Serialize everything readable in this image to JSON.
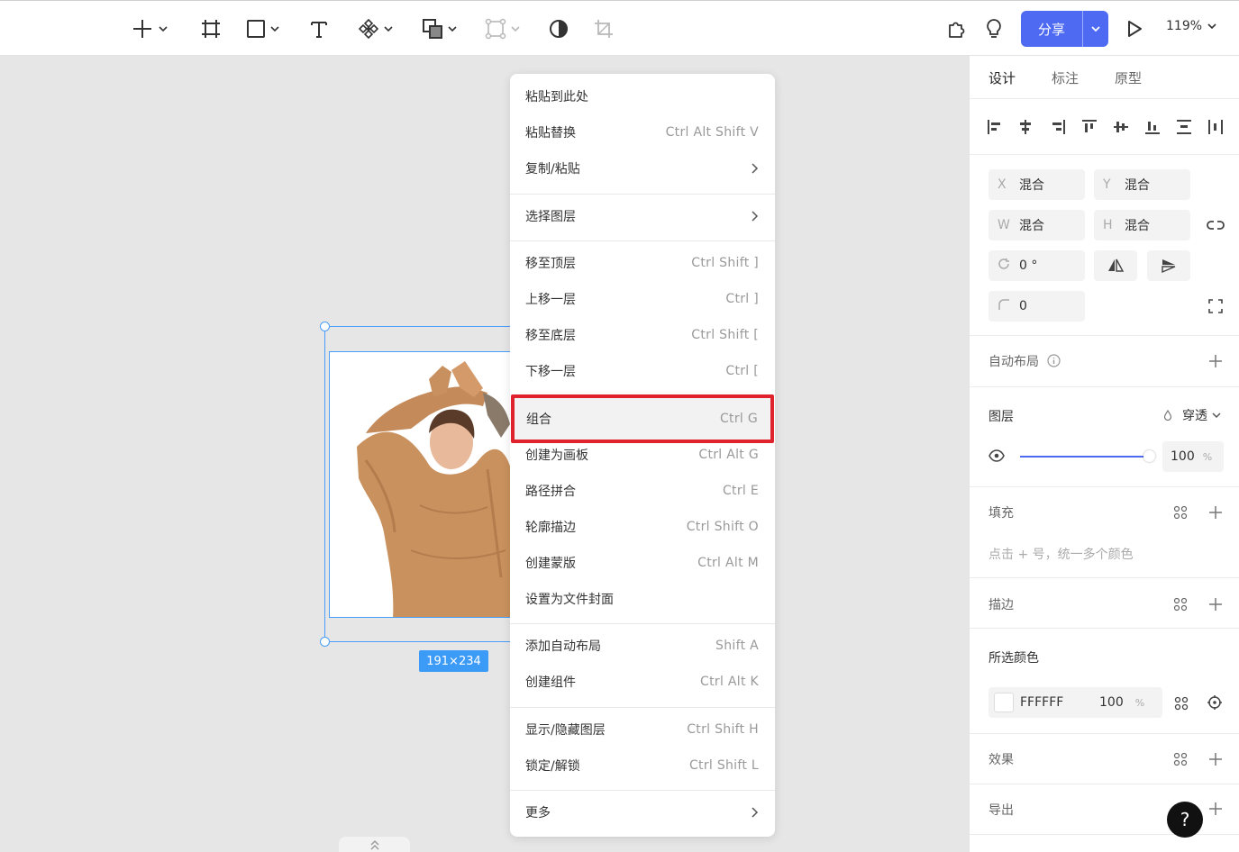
{
  "toolbar": {
    "share_label": "分享",
    "zoom_label": "119%"
  },
  "canvas": {
    "size_badge": "191×234"
  },
  "menu": {
    "items": [
      {
        "label": "粘贴到此处",
        "shortcut": ""
      },
      {
        "label": "粘贴替换",
        "shortcut": "Ctrl Alt Shift V"
      },
      {
        "label": "复制/粘贴",
        "shortcut": ""
      },
      {
        "label": "选择图层",
        "shortcut": ""
      },
      {
        "label": "移至顶层",
        "shortcut": "Ctrl Shift ]"
      },
      {
        "label": "上移一层",
        "shortcut": "Ctrl ]"
      },
      {
        "label": "移至底层",
        "shortcut": "Ctrl Shift ["
      },
      {
        "label": "下移一层",
        "shortcut": "Ctrl ["
      },
      {
        "label": "组合",
        "shortcut": "Ctrl G"
      },
      {
        "label": "创建为画板",
        "shortcut": "Ctrl Alt G"
      },
      {
        "label": "路径拼合",
        "shortcut": "Ctrl E"
      },
      {
        "label": "轮廓描边",
        "shortcut": "Ctrl Shift O"
      },
      {
        "label": "创建蒙版",
        "shortcut": "Ctrl Alt M"
      },
      {
        "label": "设置为文件封面",
        "shortcut": ""
      },
      {
        "label": "添加自动布局",
        "shortcut": "Shift A"
      },
      {
        "label": "创建组件",
        "shortcut": "Ctrl Alt K"
      },
      {
        "label": "显示/隐藏图层",
        "shortcut": "Ctrl Shift H"
      },
      {
        "label": "锁定/解锁",
        "shortcut": "Ctrl Shift L"
      },
      {
        "label": "更多",
        "shortcut": ""
      }
    ]
  },
  "panel": {
    "tabs": [
      "设计",
      "标注",
      "原型"
    ],
    "x_label": "X",
    "x_value": "混合",
    "y_label": "Y",
    "y_value": "混合",
    "w_label": "W",
    "w_value": "混合",
    "h_label": "H",
    "h_value": "混合",
    "rotation_value": "0 °",
    "radius_value": "0",
    "auto_layout_title": "自动布局",
    "layer_title": "图层",
    "blend_mode": "穿透",
    "opacity_value": "100",
    "opacity_fraction": 1.0,
    "percent_sign": "%",
    "fill_title": "填充",
    "fill_hint": "点击 + 号，统一多个颜色",
    "stroke_title": "描边",
    "selected_colors_title": "所选颜色",
    "color_hex": "FFFFFF",
    "color_opacity": "100",
    "color_swatch": "#FFFFFF",
    "effects_title": "效果",
    "export_title": "导出"
  },
  "help_label": "?",
  "colors": {
    "accent": "#4e6af3",
    "selection": "#4a9df8",
    "highlight_border": "#e0222d"
  }
}
